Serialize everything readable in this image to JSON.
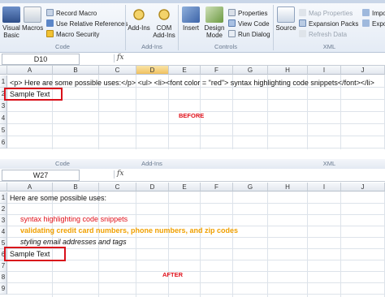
{
  "ribbon": {
    "code_group": {
      "label": "Code",
      "visual_basic": "Visual Basic",
      "macros": "Macros",
      "record_macro": "Record Macro",
      "relative_refs": "Use Relative References",
      "macro_security": "Macro Security"
    },
    "addins_group": {
      "label": "Add-Ins",
      "addins": "Add-Ins",
      "com_addins": "COM Add-Ins"
    },
    "controls_group": {
      "label": "Controls",
      "insert": "Insert",
      "design_mode": "Design Mode",
      "properties": "Properties",
      "view_code": "View Code",
      "run_dialog": "Run Dialog"
    },
    "xml_group": {
      "label": "XML",
      "source": "Source",
      "map_properties": "Map Properties",
      "expansion_packs": "Expansion Packs",
      "refresh_data": "Refresh Data",
      "import": "Impor",
      "export": "Expor"
    }
  },
  "before": {
    "name_box": "D10",
    "fx": "fx",
    "columns": [
      "A",
      "B",
      "C",
      "D",
      "E",
      "F",
      "G",
      "H",
      "I",
      "J"
    ],
    "rows": [
      "1",
      "2",
      "3",
      "4",
      "5",
      "6"
    ],
    "row1_text": "<p> Here are some possible uses:</p> <ul> <li><font color = \"red\"> syntax highlighting code snippets</font></li>",
    "row2_text": "Sample Text",
    "label": "BEFORE"
  },
  "after": {
    "name_box": "W27",
    "fx": "fx",
    "columns": [
      "A",
      "B",
      "C",
      "D",
      "E",
      "F",
      "G",
      "H",
      "I",
      "J"
    ],
    "rows": [
      "1",
      "2",
      "3",
      "4",
      "5",
      "6",
      "7",
      "8",
      "9"
    ],
    "line1": "Here are some possible uses:",
    "line3": "syntax highlighting code snippets",
    "line4": "validating credit card numbers, phone numbers, and zip codes",
    "line5": "styling email addresses and tags",
    "line6": "Sample Text",
    "label": "AFTER"
  },
  "divider": {
    "code": "Code",
    "addins": "Add-Ins",
    "xml": "XML"
  },
  "colors": {
    "red_text": "#e0101a",
    "orange_text": "#f0a000",
    "highlight_box": "#d9101a",
    "selected_col": "#f1c15f"
  }
}
